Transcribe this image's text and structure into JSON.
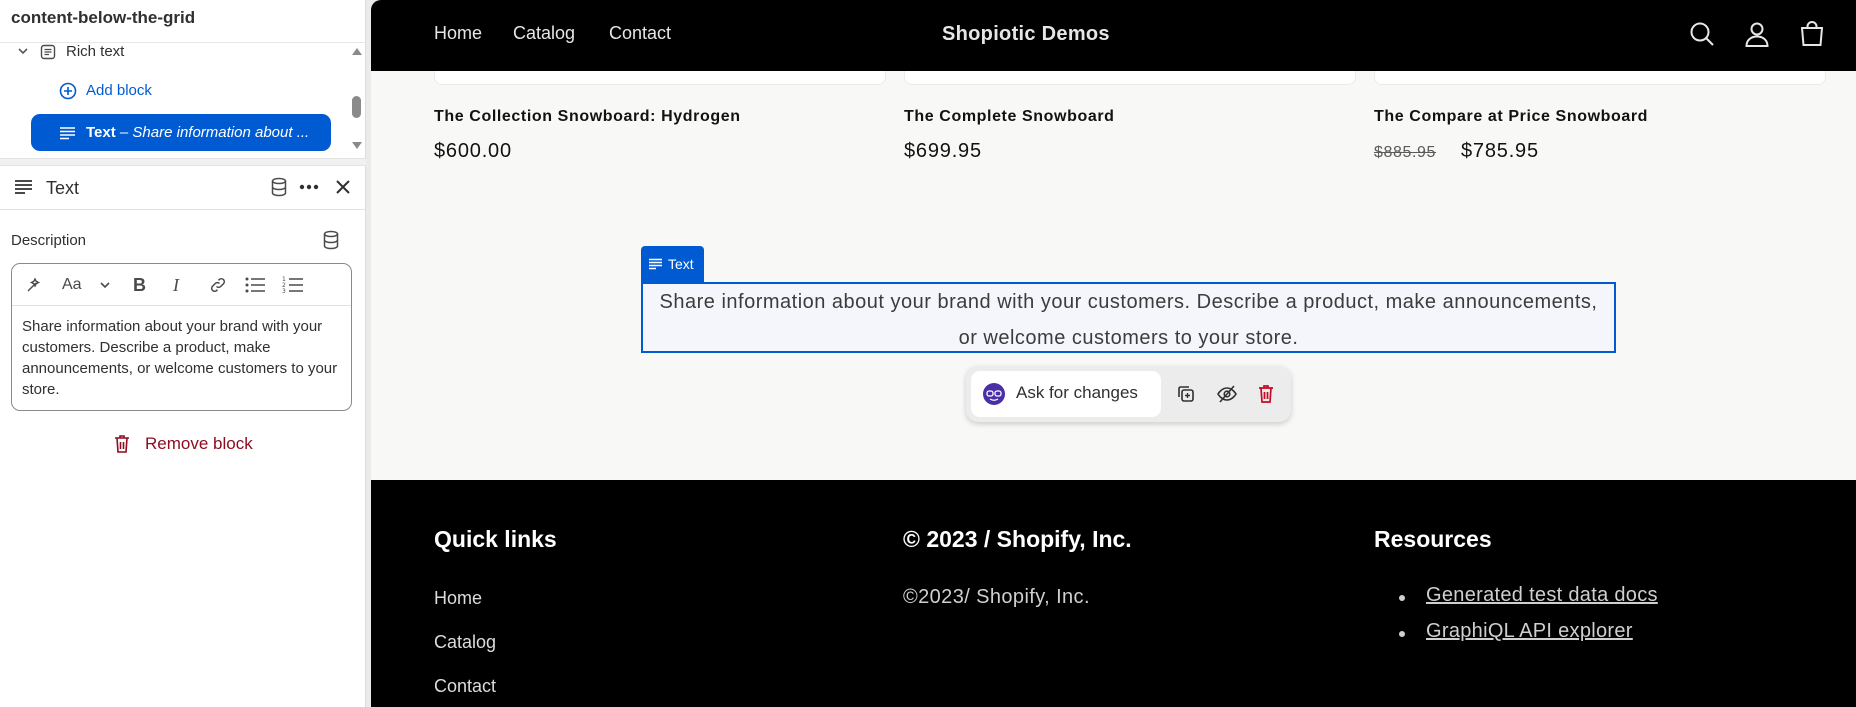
{
  "sidebar": {
    "section_title": "content-below-the-grid",
    "tree": {
      "rich_text_label": "Rich text",
      "add_block_label": "Add block",
      "selected_block": {
        "name": "Text",
        "separator": " – ",
        "preview": "Share information about ..."
      }
    },
    "block_panel": {
      "title": "Text",
      "description_label": "Description",
      "editor_text": "Share information about your brand with your customers. Describe a product, make announcements, or welcome customers to your store.",
      "remove_label": "Remove block"
    }
  },
  "store": {
    "brand": "Shopiotic Demos",
    "nav": [
      "Home",
      "Catalog",
      "Contact"
    ],
    "products": [
      {
        "title": "The Collection Snowboard: Hydrogen",
        "price": "$600.00"
      },
      {
        "title": "The Complete Snowboard",
        "price": "$699.95"
      },
      {
        "title": "The Compare at Price Snowboard",
        "compare_price": "$885.95",
        "price": "$785.95"
      }
    ],
    "rich_text": {
      "tag_label": "Text",
      "line1": "Share information about your brand with your customers. Describe a product, make announcements,",
      "line2": "or welcome customers to your store."
    },
    "ask_bar": {
      "label": "Ask for changes"
    },
    "footer": {
      "quick_links_title": "Quick links",
      "quick_links": [
        "Home",
        "Catalog",
        "Contact"
      ],
      "copyright_title": "© 2023 / Shopify, Inc.",
      "copyright_text": "©2023/ Shopify, Inc.",
      "resources_title": "Resources",
      "resources": [
        "Generated test data docs",
        "GraphiQL API explorer"
      ]
    }
  },
  "colors": {
    "accent": "#005bd3",
    "danger": "#8e0b21",
    "header_bg": "#000000"
  }
}
